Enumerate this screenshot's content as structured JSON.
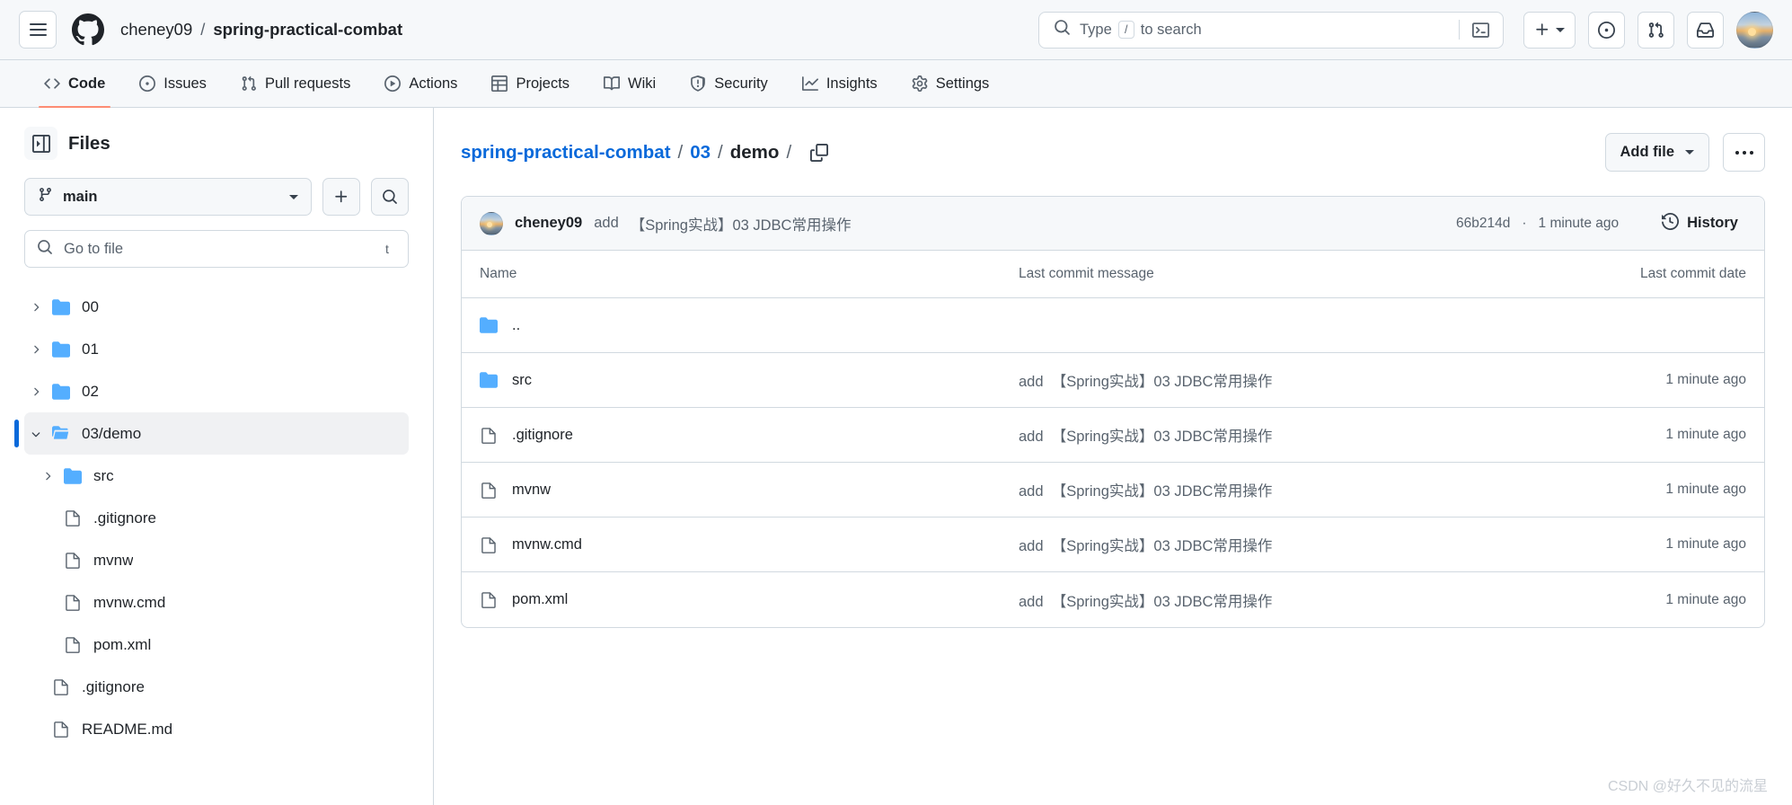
{
  "header": {
    "menu_icon": "hamburger-icon",
    "logo_icon": "github-mark-icon",
    "owner": "cheney09",
    "separator": "/",
    "repo": "spring-practical-combat",
    "search": {
      "icon": "search-icon",
      "placeholder_prefix": "Type",
      "slash_key": "/",
      "placeholder_suffix": "to search",
      "terminal_icon": "terminal-icon"
    },
    "actions": [
      {
        "name": "create-new-button",
        "icon": "plus-icon",
        "caret": true
      },
      {
        "name": "issues-button",
        "icon": "issue-opened-icon",
        "caret": false
      },
      {
        "name": "pull-requests-button",
        "icon": "git-pull-request-icon",
        "caret": false
      },
      {
        "name": "notifications-button",
        "icon": "inbox-icon",
        "caret": false
      }
    ],
    "avatar": "user-avatar"
  },
  "nav": {
    "tabs": [
      {
        "label": "Code",
        "icon": "code-icon",
        "active": true
      },
      {
        "label": "Issues",
        "icon": "issue-opened-icon",
        "active": false
      },
      {
        "label": "Pull requests",
        "icon": "git-pull-request-icon",
        "active": false
      },
      {
        "label": "Actions",
        "icon": "play-icon",
        "active": false
      },
      {
        "label": "Projects",
        "icon": "table-icon",
        "active": false
      },
      {
        "label": "Wiki",
        "icon": "book-icon",
        "active": false
      },
      {
        "label": "Security",
        "icon": "shield-icon",
        "active": false
      },
      {
        "label": "Insights",
        "icon": "graph-icon",
        "active": false
      },
      {
        "label": "Settings",
        "icon": "gear-icon",
        "active": false
      }
    ]
  },
  "sidebar": {
    "collapse_icon": "sidebar-collapse-icon",
    "title": "Files",
    "branch": {
      "icon": "git-branch-icon",
      "name": "main",
      "caret_icon": "chevron-down-icon"
    },
    "add_button_icon": "plus-icon",
    "search_button_icon": "search-icon",
    "go_to_file": {
      "icon": "search-icon",
      "placeholder": "Go to file",
      "shortcut": "t"
    },
    "tree": [
      {
        "label": "00",
        "type": "folder",
        "depth": 0,
        "expanded": false,
        "selected": false
      },
      {
        "label": "01",
        "type": "folder",
        "depth": 0,
        "expanded": false,
        "selected": false
      },
      {
        "label": "02",
        "type": "folder",
        "depth": 0,
        "expanded": false,
        "selected": false
      },
      {
        "label": "03/demo",
        "type": "folder",
        "depth": 0,
        "expanded": true,
        "selected": true
      },
      {
        "label": "src",
        "type": "folder",
        "depth": 1,
        "expanded": false,
        "selected": false
      },
      {
        "label": ".gitignore",
        "type": "file",
        "depth": 1,
        "selected": false
      },
      {
        "label": "mvnw",
        "type": "file",
        "depth": 1,
        "selected": false
      },
      {
        "label": "mvnw.cmd",
        "type": "file",
        "depth": 1,
        "selected": false
      },
      {
        "label": "pom.xml",
        "type": "file",
        "depth": 1,
        "selected": false
      },
      {
        "label": ".gitignore",
        "type": "file",
        "depth": 0,
        "selected": false
      },
      {
        "label": "README.md",
        "type": "file",
        "depth": 0,
        "selected": false
      }
    ]
  },
  "main": {
    "breadcrumb": [
      {
        "label": "spring-practical-combat",
        "link": true
      },
      {
        "label": "03",
        "link": true
      },
      {
        "label": "demo",
        "link": false
      }
    ],
    "breadcrumb_separator": "/",
    "copy_path_icon": "copy-icon",
    "add_file_label": "Add file",
    "add_file_caret_icon": "chevron-down-icon",
    "kebab_icon": "kebab-horizontal-icon",
    "commit_bar": {
      "avatar": "author-avatar",
      "author": "cheney09",
      "message_prefix": "add",
      "message": "【Spring实战】03 JDBC常用操作",
      "hash": "66b214d",
      "meta_separator": "·",
      "relative_time": "1 minute ago",
      "history_icon": "history-icon",
      "history_label": "History"
    },
    "table": {
      "columns": {
        "name": "Name",
        "message": "Last commit message",
        "date": "Last commit date"
      },
      "rows": [
        {
          "name": "..",
          "type": "parent",
          "message": "",
          "date": ""
        },
        {
          "name": "src",
          "type": "folder",
          "message_prefix": "add",
          "message": "【Spring实战】03 JDBC常用操作",
          "date": "1 minute ago"
        },
        {
          "name": ".gitignore",
          "type": "file",
          "message_prefix": "add",
          "message": "【Spring实战】03 JDBC常用操作",
          "date": "1 minute ago"
        },
        {
          "name": "mvnw",
          "type": "file",
          "message_prefix": "add",
          "message": "【Spring实战】03 JDBC常用操作",
          "date": "1 minute ago"
        },
        {
          "name": "mvnw.cmd",
          "type": "file",
          "message_prefix": "add",
          "message": "【Spring实战】03 JDBC常用操作",
          "date": "1 minute ago"
        },
        {
          "name": "pom.xml",
          "type": "file",
          "message_prefix": "add",
          "message": "【Spring实战】03 JDBC常用操作",
          "date": "1 minute ago"
        }
      ]
    },
    "watermark": "CSDN @好久不见的流星"
  },
  "colors": {
    "accent_blue": "#0969da",
    "folder_blue": "#54aeff",
    "active_tab_underline": "#fd8c73",
    "header_bg": "#f6f8fa",
    "border": "#d1d9e0",
    "muted_text": "#59636e"
  }
}
